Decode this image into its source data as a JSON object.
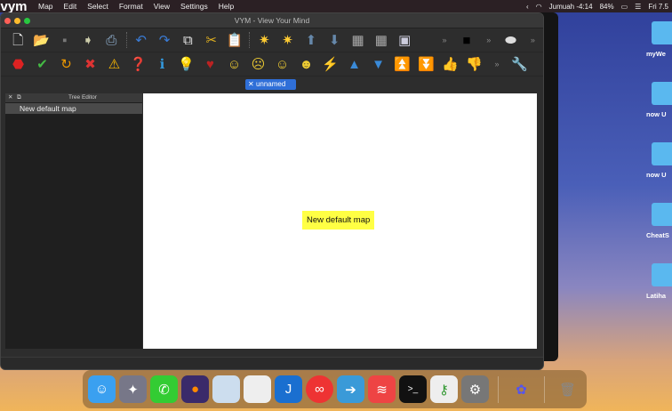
{
  "menubar": {
    "app": "vym",
    "items": [
      "Map",
      "Edit",
      "Select",
      "Format",
      "View",
      "Settings",
      "Help"
    ],
    "status": {
      "wifi": "wifi-icon",
      "user": "Jumuah -4:14",
      "battery": "84%",
      "clock": "Fri 7.5"
    }
  },
  "window": {
    "title": "VYM - View Your Mind",
    "tab": "unnamed",
    "tree_editor": {
      "title": "Tree Editor",
      "items": [
        "New default map"
      ]
    },
    "node": "New default map"
  },
  "toolbar1": [
    "new-map",
    "open",
    "save",
    "export",
    "print",
    "undo",
    "redo",
    "copy",
    "cut",
    "paste",
    "add-branch",
    "add-branch-above",
    "move-up",
    "move-down",
    "sort",
    "sort-back",
    "image"
  ],
  "toolbar2": [
    "stop",
    "check",
    "refresh",
    "cross",
    "warning",
    "question",
    "info",
    "lightbulb",
    "heart",
    "smiley-good",
    "smiley-sad",
    "smiley-neutral",
    "smiley-omg",
    "flash",
    "arrow-up",
    "arrow-down",
    "arrow-double-up",
    "arrow-double-down",
    "thumbs-up",
    "thumbs-down"
  ],
  "desktop": {
    "folders": [
      "myWe",
      "now U",
      "now U",
      "CheatS",
      "Latiha"
    ]
  },
  "dock": [
    "Finder",
    "Xcode",
    "WhatsApp",
    "Firefox",
    "Preview",
    "LibreOffice",
    "Joplin",
    "Authy",
    "Migration",
    "Todoist",
    "Terminal",
    "Keychain",
    "System Preferences",
    "VYM",
    "Trash"
  ]
}
